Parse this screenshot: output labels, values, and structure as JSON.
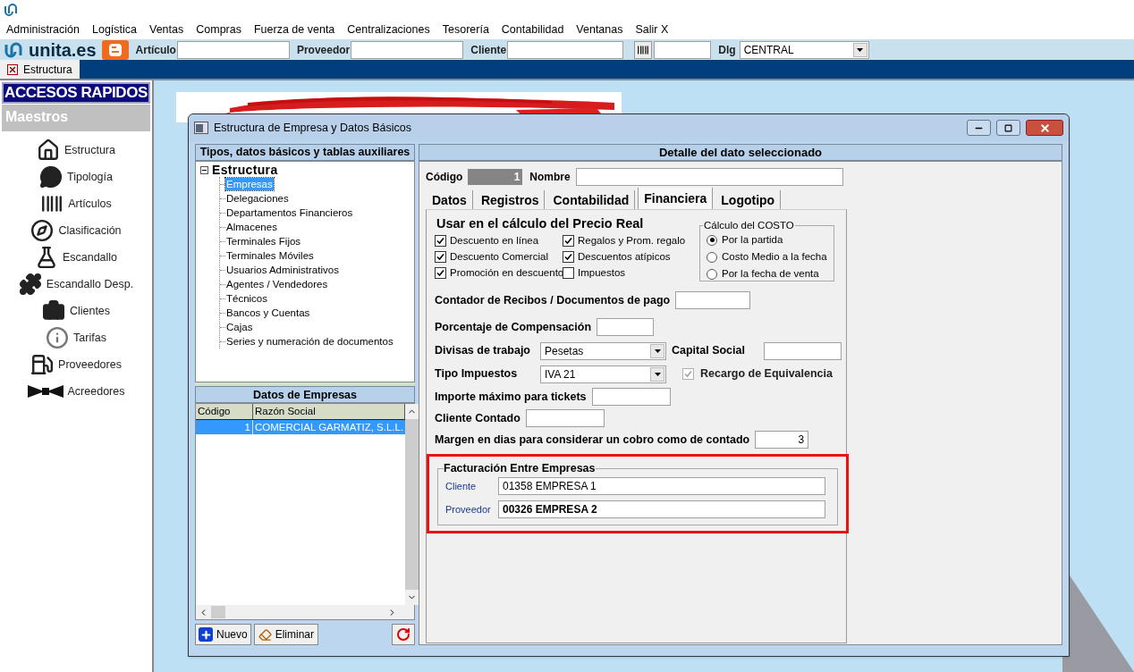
{
  "menu": [
    "Administración",
    "Logística",
    "Ventas",
    "Compras",
    "Fuerza de venta",
    "Centralizaciones",
    "Tesorería",
    "Contabilidad",
    "Ventanas",
    "Salir X"
  ],
  "toolbar": {
    "logo": "unita.es",
    "fields": [
      {
        "kind": "text",
        "label": "Artículo"
      },
      {
        "kind": "text",
        "label": "Proveedor"
      },
      {
        "kind": "text",
        "label": "Cliente"
      },
      {
        "kind": "barcode"
      },
      {
        "kind": "select",
        "label": "Dlg",
        "value": "CENTRAL"
      }
    ]
  },
  "document_tabs": [
    {
      "label": "Estructura",
      "selected": true
    }
  ],
  "sidebar": {
    "title": "ACCESOS RAPIDOS",
    "section": "Maestros",
    "items": [
      "Estructura",
      "Tipología",
      "Artículos",
      "Clasificación",
      "Escandallo",
      "Escandallo Desp.",
      "Clientes",
      "Tarifas",
      "Proveedores",
      "Acreedores"
    ]
  },
  "dialog": {
    "title": "Estructura de Empresa y Datos Básicos",
    "left_panel": {
      "title": "Tipos, datos básicos y tablas auxiliares",
      "tree": {
        "label": "Estructura",
        "expanded": true,
        "children": [
          {
            "label": "Empresas",
            "selected": true
          },
          {
            "label": "Delegaciones",
            "selected": false
          },
          {
            "label": "Departamentos Financieros",
            "selected": false
          },
          {
            "label": "Almacenes",
            "selected": false
          },
          {
            "label": "Terminales Fijos",
            "selected": false
          },
          {
            "label": "Terminales Móviles",
            "selected": false
          },
          {
            "label": "Usuarios Administrativos",
            "selected": false
          },
          {
            "label": "Agentes / Vendedores",
            "selected": false
          },
          {
            "label": "Técnicos",
            "selected": false
          },
          {
            "label": "Bancos y Cuentas",
            "selected": false
          },
          {
            "label": "Cajas",
            "selected": false
          },
          {
            "label": "Series y numeración de documentos",
            "selected": false
          }
        ]
      }
    },
    "grid": {
      "title": "Datos de Empresas",
      "columns": [
        "Código",
        "Razón Social"
      ],
      "rows": [
        {
          "cells": [
            "1",
            "COMERCIAL GARMATIZ, S.L.L."
          ],
          "selected": true
        }
      ]
    },
    "buttons": [
      {
        "kind": "new",
        "label": "Nuevo"
      },
      {
        "kind": "delete",
        "label": "Eliminar"
      },
      {
        "kind": "refresh"
      }
    ],
    "detail": {
      "title": "Detalle del dato seleccionado",
      "code_label": "Código",
      "code_value": "1",
      "name_label": "Nombre",
      "tabs": [
        {
          "label": "Datos",
          "selected": false
        },
        {
          "label": "Registros",
          "selected": false
        },
        {
          "label": "Contabilidad",
          "selected": false
        },
        {
          "label": "Financiera",
          "selected": true
        },
        {
          "label": "Logotipo",
          "selected": false
        }
      ],
      "price_title": "Usar en el cálculo del Precio Real",
      "price_checks": [
        {
          "label": "Descuento en línea",
          "checked": true
        },
        {
          "label": "Regalos y Prom. regalo",
          "checked": true
        },
        {
          "label": "Descuento Comercial",
          "checked": true
        },
        {
          "label": "Descuentos atípicos",
          "checked": true
        },
        {
          "label": "Promoción en descuento",
          "checked": true
        },
        {
          "label": "Impuestos",
          "checked": false
        }
      ],
      "cost_group": {
        "title": "Cálculo del COSTO",
        "options": [
          {
            "label": "Por la partida",
            "selected": true
          },
          {
            "label": "Costo Medio a la fecha",
            "selected": false
          },
          {
            "label": "Por la fecha de venta",
            "selected": false
          }
        ]
      },
      "rows": [
        {
          "items": [
            {
              "kind": "label",
              "text": "Contador de Recibos / Documentos de pago"
            },
            {
              "kind": "input"
            }
          ]
        },
        {
          "items": [
            {
              "kind": "label",
              "text": "Porcentaje de Compensación"
            },
            {
              "kind": "input"
            }
          ]
        },
        {
          "items": [
            {
              "kind": "label",
              "text": "Divisas de trabajo"
            },
            {
              "kind": "select",
              "value": "Pesetas"
            },
            {
              "kind": "label",
              "text": "Capital Social"
            },
            {
              "kind": "input"
            }
          ]
        },
        {
          "items": [
            {
              "kind": "label",
              "text": "Tipo Impuestos"
            },
            {
              "kind": "select",
              "value": "IVA 21"
            },
            {
              "kind": "checkbox",
              "label": "Recargo de Equivalencia",
              "checked": true,
              "disabled": true
            }
          ]
        },
        {
          "items": [
            {
              "kind": "label",
              "text": "Importe máximo para tickets"
            },
            {
              "kind": "input"
            }
          ]
        },
        {
          "items": [
            {
              "kind": "label",
              "text": "Cliente Contado"
            },
            {
              "kind": "input"
            }
          ]
        },
        {
          "items": [
            {
              "kind": "label",
              "text": "Margen en dias para considerar un cobro como de contado"
            },
            {
              "kind": "input",
              "value": "3"
            }
          ]
        }
      ],
      "billing": {
        "title": "Facturación Entre Empresas",
        "highlighted": true,
        "fields": [
          {
            "label": "Cliente",
            "value": "01358 EMPRESA 1",
            "bold": false
          },
          {
            "label": "Proveedor",
            "value": "00326 EMPRESA 2",
            "bold": true
          }
        ]
      }
    }
  }
}
